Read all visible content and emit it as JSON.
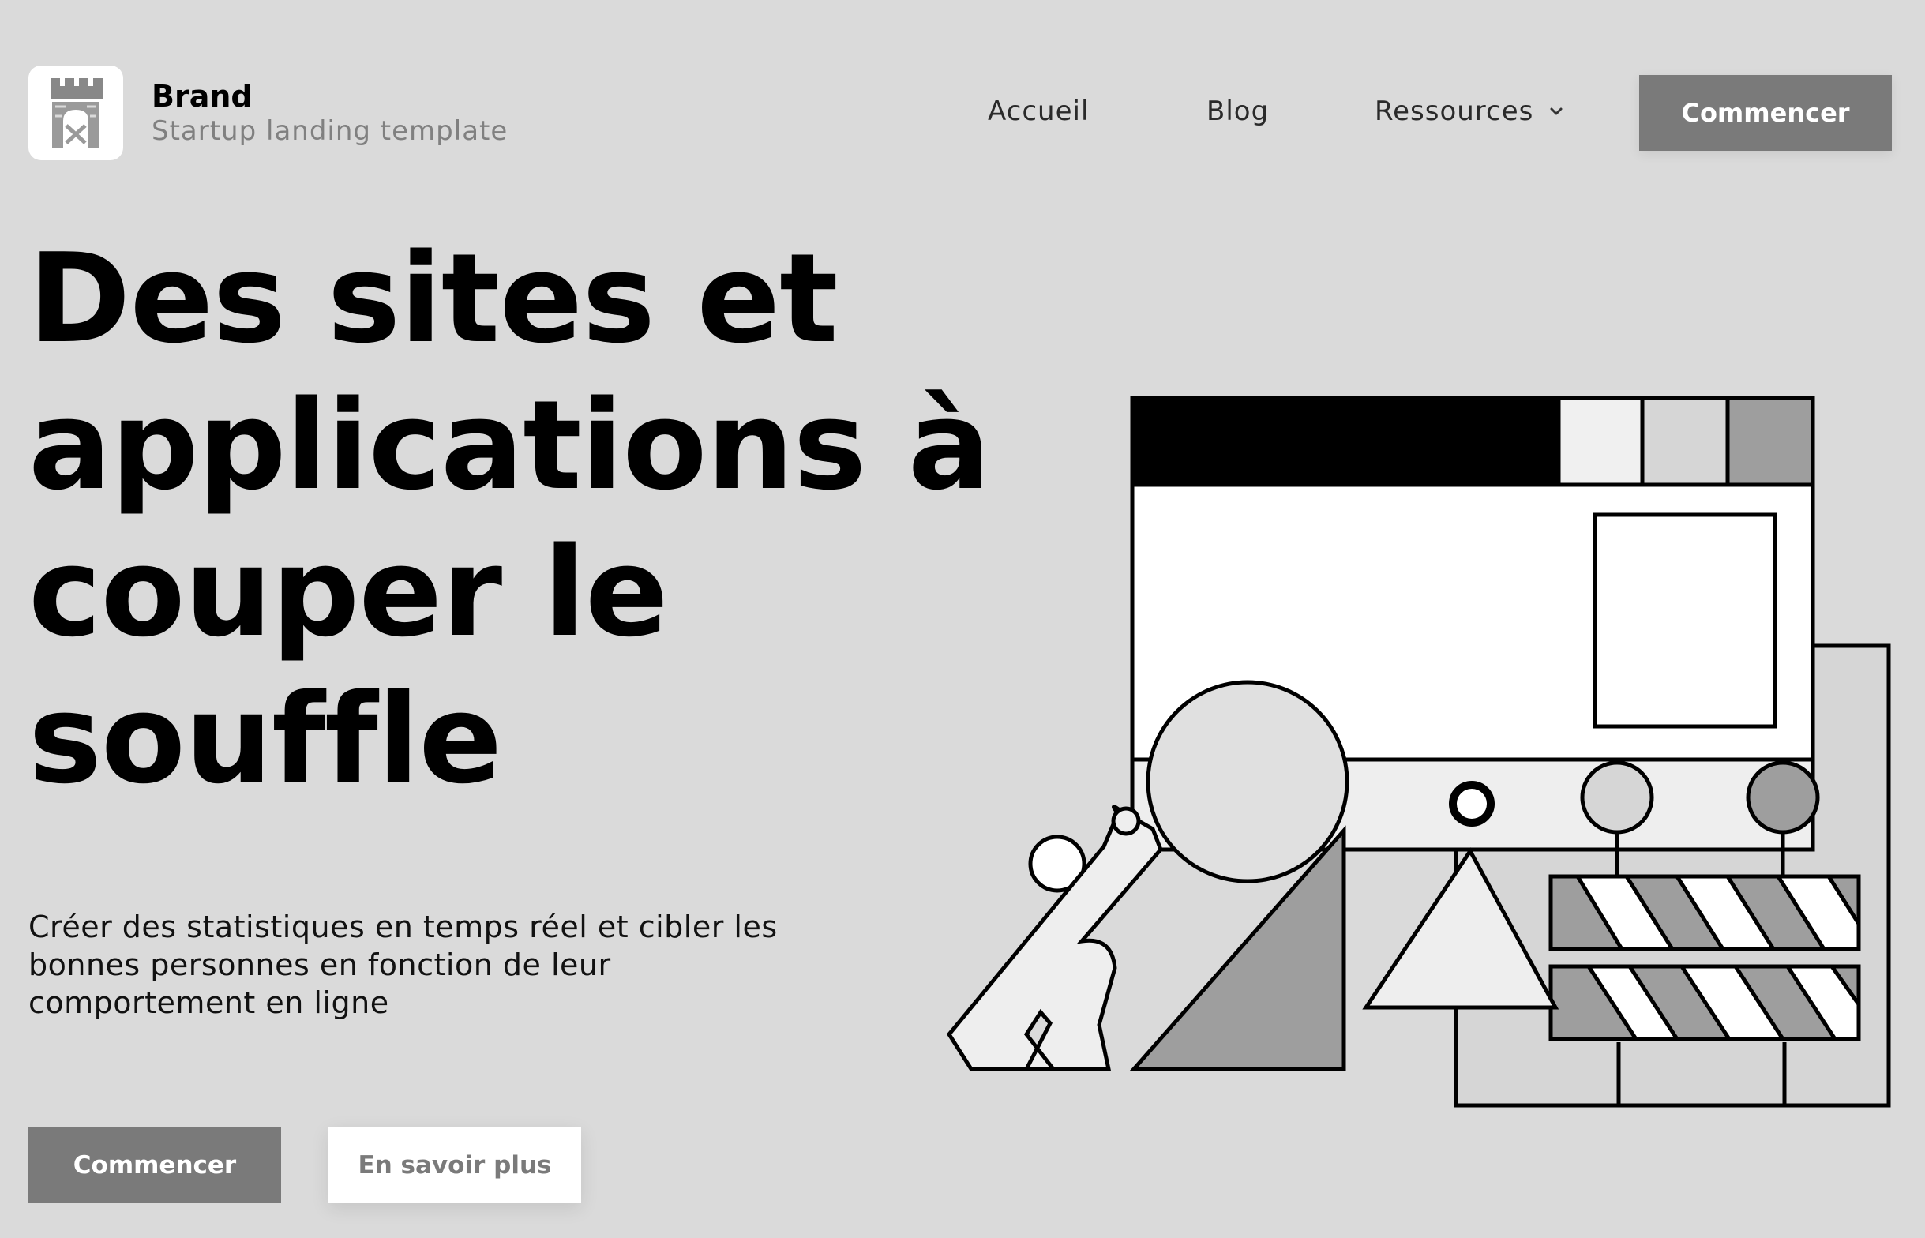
{
  "header": {
    "brand_name": "Brand",
    "brand_tagline": "Startup landing template",
    "logo_icon": "castle-tower-icon",
    "nav": {
      "home": "Accueil",
      "blog": "Blog",
      "resources": "Ressources"
    },
    "cta_label": "Commencer"
  },
  "hero": {
    "title_lines": [
      "Des sites et",
      "applications à",
      "couper le",
      "souffle"
    ],
    "subtitle_lines": [
      "Créer des statistiques en temps réel et cibler les",
      "bonnes personnes en fonction de leur",
      "comportement en ligne"
    ],
    "primary_cta": "Commencer",
    "secondary_cta": "En savoir plus"
  },
  "illustration": {
    "description_icon": "construction-website-illustration"
  },
  "colors": {
    "background": "#dadada",
    "button_primary": "#7a7a7a",
    "button_secondary": "#ffffff",
    "text": "#000000",
    "muted": "#808080"
  }
}
